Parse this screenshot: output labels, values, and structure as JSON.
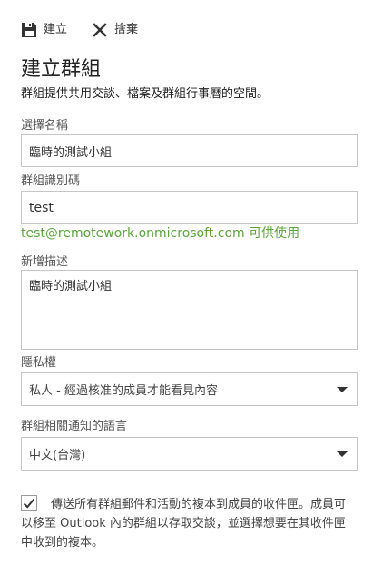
{
  "toolbar": {
    "create_label": "建立",
    "discard_label": "捨棄"
  },
  "form": {
    "title": "建立群組",
    "subtitle": "群組提供共用交談、檔案及群組行事曆的空間。",
    "name": {
      "label": "選擇名稱",
      "value": "臨時的測試小組"
    },
    "alias": {
      "label": "群組識別碼",
      "value": "test",
      "availability": "test@remotework.onmicrosoft.com 可供使用"
    },
    "description": {
      "label": "新增描述",
      "value": "臨時的測試小組"
    },
    "privacy": {
      "label": "隱私權",
      "selected": "私人 - 經過核准的成員才能看見內容"
    },
    "language": {
      "label": "群組相關通知的語言",
      "selected": "中文(台灣)"
    },
    "subscribe": {
      "checked": true,
      "text": "傳送所有群組郵件和活動的複本到成員的收件匣。成員可以移至 Outlook 內的群組以存取交談，並選擇想要在其收件匣中收到的複本。"
    }
  },
  "colors": {
    "available_text": "#5aa73a",
    "border": "#c6c6c6",
    "text": "#333333"
  }
}
